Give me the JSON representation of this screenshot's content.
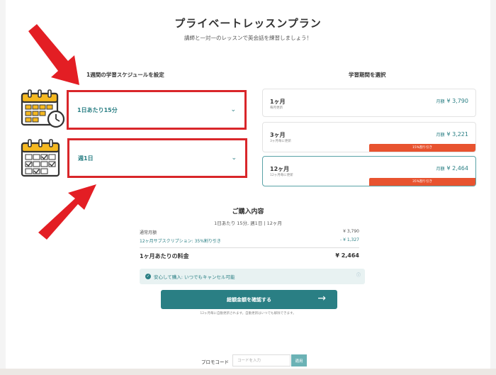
{
  "header": {
    "title": "プライベートレッスンプラン",
    "subtitle": "講師と一対一のレッスンで英会話を練習しましょう！"
  },
  "schedule": {
    "label": "1週間の学習スケジュールを設定",
    "per_day": "1日あたり15分",
    "per_week": "週1日"
  },
  "period": {
    "label": "学習期間を選択",
    "plans": [
      {
        "name": "1ヶ月",
        "note": "毎月更新",
        "price_label": "月額",
        "price": "¥ 3,790",
        "badge": ""
      },
      {
        "name": "3ヶ月",
        "note": "3ヶ月毎に更新",
        "price_label": "月額",
        "price": "¥ 3,221",
        "badge": "15%割り引き"
      },
      {
        "name": "12ヶ月",
        "note": "12ヶ月毎に更新",
        "price_label": "月額",
        "price": "¥ 2,464",
        "badge": "35%割り引き"
      }
    ],
    "selected_index": 2
  },
  "summary": {
    "title": "ご購入内容",
    "subtitle": "1日あたり 15分, 週1日 | 12ヶ月",
    "regular_label": "通常月額",
    "regular_value": "¥ 3,790",
    "discount_label": "12ヶ月サブスクリプション: 35%割り引き",
    "discount_value": "- ¥ 1,327",
    "total_label": "1ヶ月あたりの料金",
    "total_value": "¥ 2,464"
  },
  "safe_notice": "安心して購入: いつでもキャンセル可能",
  "cta": {
    "label": "総額金額を確認する"
  },
  "note": "12ヶ月毎に自動更新されます。自動更新はいつでも解除できます。",
  "promo": {
    "label": "プロモコード",
    "placeholder": "コードを入力",
    "button": "適用"
  },
  "colors": {
    "teal": "#2a7f84",
    "annotation_red": "#d9262a",
    "badge_orange": "#e8532f",
    "calendar_yellow": "#f5b820"
  }
}
